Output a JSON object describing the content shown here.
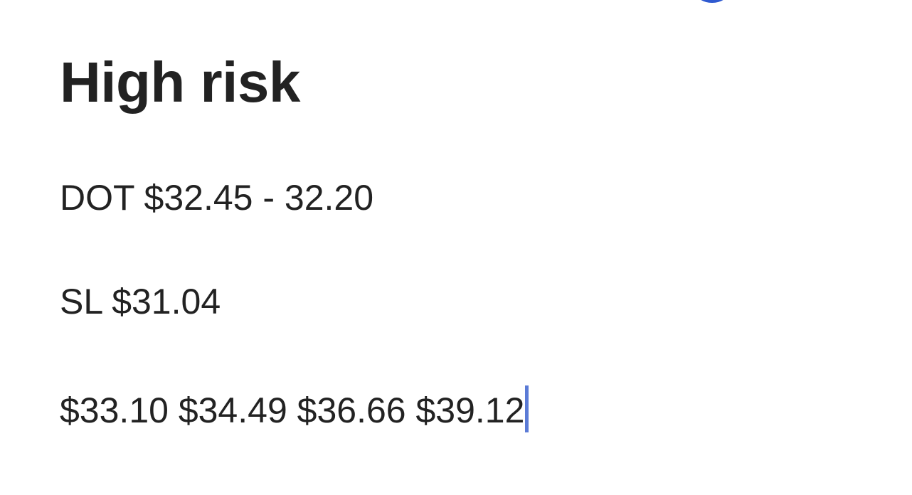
{
  "note": {
    "heading": "High risk",
    "entry_line": "DOT $32.45 - 32.20",
    "stop_loss_line": "SL $31.04",
    "targets_line": "$33.10 $34.49 $36.66 $39.12"
  },
  "colors": {
    "text": "#222222",
    "caret": "#5b7bd6",
    "accent": "#2f5ad0",
    "background": "#ffffff"
  },
  "icons": {
    "top_indicator": "circle-outline-icon"
  }
}
